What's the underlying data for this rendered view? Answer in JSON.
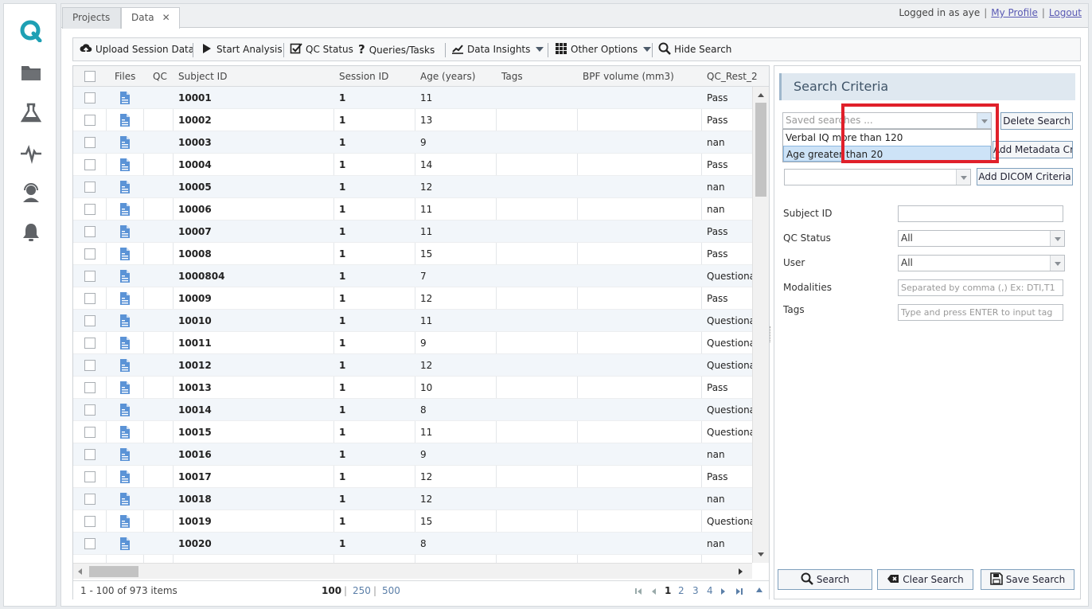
{
  "tabs": [
    {
      "label": "Projects",
      "active": false
    },
    {
      "label": "Data",
      "active": true,
      "close": "✕"
    }
  ],
  "login": {
    "prefix": "Logged in as",
    "user": "aye",
    "sep": "|",
    "profile": "My Profile",
    "logout": "Logout"
  },
  "toolbar": {
    "upload": "Upload Session Data",
    "start": "Start Analysis",
    "qc": "QC Status",
    "queries": "Queries/Tasks",
    "insights": "Data Insights",
    "other": "Other Options",
    "hide": "Hide Search"
  },
  "grid": {
    "columns": [
      "Files",
      "QC",
      "Subject ID",
      "Session ID",
      "Age (years)",
      "Tags",
      "BPF volume (mm3)",
      "QC_Rest_2"
    ],
    "rows": [
      {
        "subject": "10001",
        "session": "1",
        "age": "11",
        "qc2": "Pass"
      },
      {
        "subject": "10002",
        "session": "1",
        "age": "13",
        "qc2": "Pass"
      },
      {
        "subject": "10003",
        "session": "1",
        "age": "9",
        "qc2": "nan"
      },
      {
        "subject": "10004",
        "session": "1",
        "age": "14",
        "qc2": "Pass"
      },
      {
        "subject": "10005",
        "session": "1",
        "age": "12",
        "qc2": "nan"
      },
      {
        "subject": "10006",
        "session": "1",
        "age": "11",
        "qc2": "nan"
      },
      {
        "subject": "10007",
        "session": "1",
        "age": "11",
        "qc2": "Pass"
      },
      {
        "subject": "10008",
        "session": "1",
        "age": "15",
        "qc2": "Pass"
      },
      {
        "subject": "1000804",
        "session": "1",
        "age": "7",
        "qc2": "Questiona"
      },
      {
        "subject": "10009",
        "session": "1",
        "age": "12",
        "qc2": "Pass"
      },
      {
        "subject": "10010",
        "session": "1",
        "age": "11",
        "qc2": "Questiona"
      },
      {
        "subject": "10011",
        "session": "1",
        "age": "9",
        "qc2": "Questiona"
      },
      {
        "subject": "10012",
        "session": "1",
        "age": "12",
        "qc2": "Questiona"
      },
      {
        "subject": "10013",
        "session": "1",
        "age": "10",
        "qc2": "Pass"
      },
      {
        "subject": "10014",
        "session": "1",
        "age": "8",
        "qc2": "Questiona"
      },
      {
        "subject": "10015",
        "session": "1",
        "age": "11",
        "qc2": "Questiona"
      },
      {
        "subject": "10016",
        "session": "1",
        "age": "9",
        "qc2": "nan"
      },
      {
        "subject": "10017",
        "session": "1",
        "age": "12",
        "qc2": "Pass"
      },
      {
        "subject": "10018",
        "session": "1",
        "age": "12",
        "qc2": "nan"
      },
      {
        "subject": "10019",
        "session": "1",
        "age": "15",
        "qc2": "Questiona"
      },
      {
        "subject": "10020",
        "session": "1",
        "age": "8",
        "qc2": "nan"
      }
    ],
    "footer": {
      "count": "1 - 100 of 973 items",
      "sizes": [
        "100",
        "250",
        "500"
      ],
      "sep": "|",
      "pages": [
        "1",
        "2",
        "3",
        "4"
      ]
    }
  },
  "search": {
    "title": "Search Criteria",
    "saved_placeholder": "Saved searches ...",
    "saved_options": [
      "Verbal IQ more than 120",
      "Age greater than 20"
    ],
    "delete_btn": "Delete Search",
    "add_meta_btn": "Add Metadata Criteria",
    "add_dicom_btn": "Add DICOM Criteria",
    "fields": {
      "subject_label": "Subject ID",
      "qc_label": "QC Status",
      "qc_value": "All",
      "user_label": "User",
      "user_value": "All",
      "modalities_label": "Modalities",
      "modalities_placeholder": "Separated by comma (,) Ex: DTI,T1",
      "tags_label": "Tags",
      "tags_placeholder": "Type and press ENTER to input tag"
    },
    "search_btn": "Search",
    "clear_btn": "Clear Search",
    "save_btn": "Save Search"
  },
  "colors": {
    "brand": "#1ea0b4",
    "highlight": "#e0202a",
    "file_icon": "#5b93d6"
  }
}
